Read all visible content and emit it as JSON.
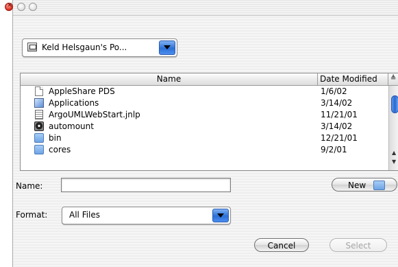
{
  "window": {
    "traffic_lights": [
      "close",
      "minimize",
      "zoom"
    ]
  },
  "location_popup": {
    "label": "Keld Helsgaun's Po...",
    "icon": "volume-icon"
  },
  "browser": {
    "columns": [
      "Name",
      "Date Modified"
    ],
    "sort_indicator": "≜",
    "rows": [
      {
        "name": "AppleShare PDS",
        "date": "1/6/02",
        "icon": "document-icon"
      },
      {
        "name": "Applications",
        "date": "3/14/02",
        "icon": "applications-folder-icon"
      },
      {
        "name": "ArgoUMLWebStart.jnlp",
        "date": "11/21/01",
        "icon": "jnlp-file-icon"
      },
      {
        "name": "automount",
        "date": "3/14/02",
        "icon": "disk-icon"
      },
      {
        "name": "bin",
        "date": "12/21/01",
        "icon": "folder-icon"
      },
      {
        "name": "cores",
        "date": "9/2/01",
        "icon": "folder-icon"
      }
    ]
  },
  "form": {
    "name_label": "Name:",
    "name_value": "",
    "new_button": "New",
    "format_label": "Format:",
    "format_value": "All Files"
  },
  "buttons": {
    "cancel": "Cancel",
    "select": "Select"
  }
}
